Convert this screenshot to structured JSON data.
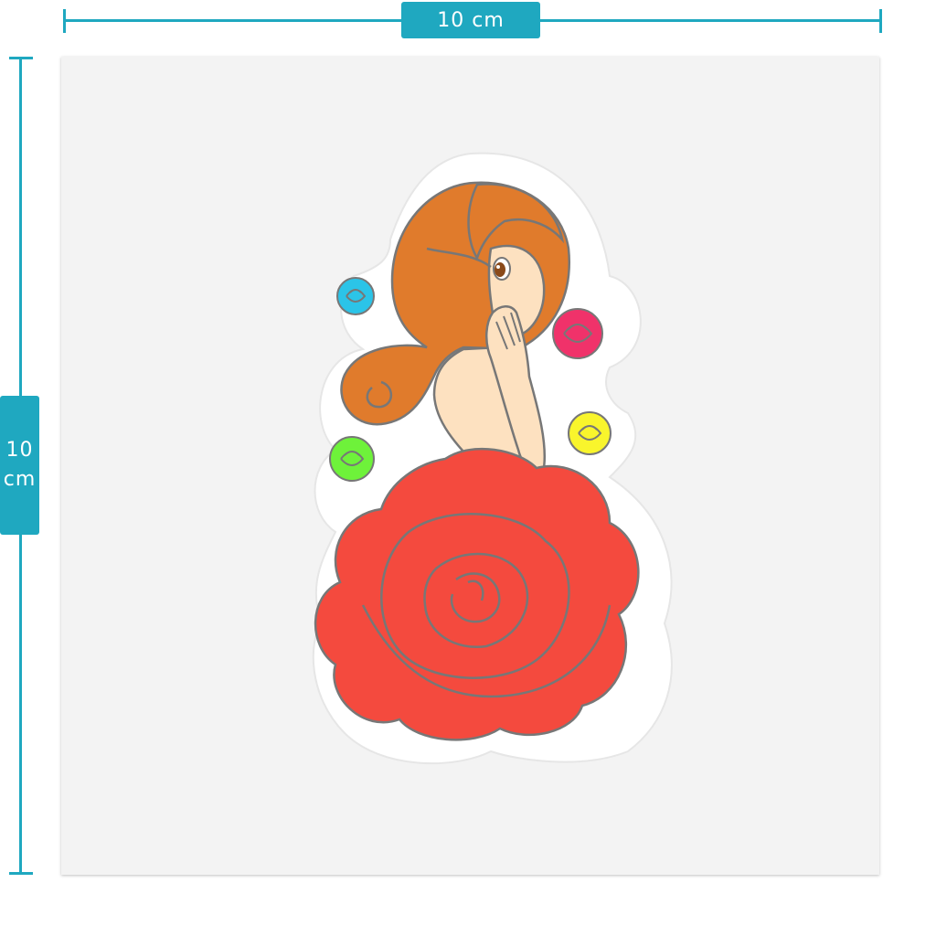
{
  "colors": {
    "accent": "#1fa8c0",
    "sheet": "#f3f3f3",
    "dress": "#f44a3e",
    "hair": "#e07b2c",
    "skin": "#fde1c0",
    "outline": "#777777",
    "rose_blue": "#2bc4e8",
    "rose_pink": "#f0326a",
    "rose_yellow": "#f9f52c",
    "rose_green": "#6ef23a"
  },
  "dimensions": {
    "width_label": "10 cm",
    "height_number": "10",
    "height_unit": "cm"
  },
  "artwork": {
    "subject_icon": "rose-dress-girl-sticker-icon",
    "small_roses": [
      "blue",
      "pink",
      "yellow",
      "green"
    ]
  }
}
